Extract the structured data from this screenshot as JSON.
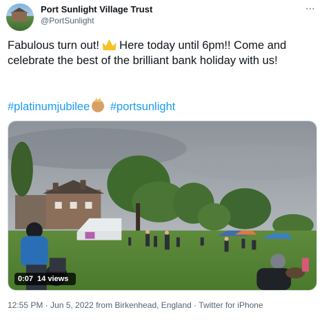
{
  "tweet": {
    "display_name": "Port Sunlight Village Trust",
    "handle": "@PortSunlight",
    "more_icon": "more-dots-icon",
    "text_part1": "Fabulous turn out! ",
    "text_part2": " Here today until 6pm!! Come and celebrate the best of the brilliant bank holiday with us!",
    "hashtags": [
      "#platinumjubilee",
      "#portsunlight"
    ],
    "timestamp": "12:55 PM · Jun 5, 2022 from Birkenhead, England · Twitter for iPhone"
  },
  "video": {
    "duration": "0:07",
    "views": "14 views"
  },
  "colors": {
    "link": "#1d9bf0",
    "secondary_text": "#536471",
    "primary_text": "#0f1419"
  }
}
